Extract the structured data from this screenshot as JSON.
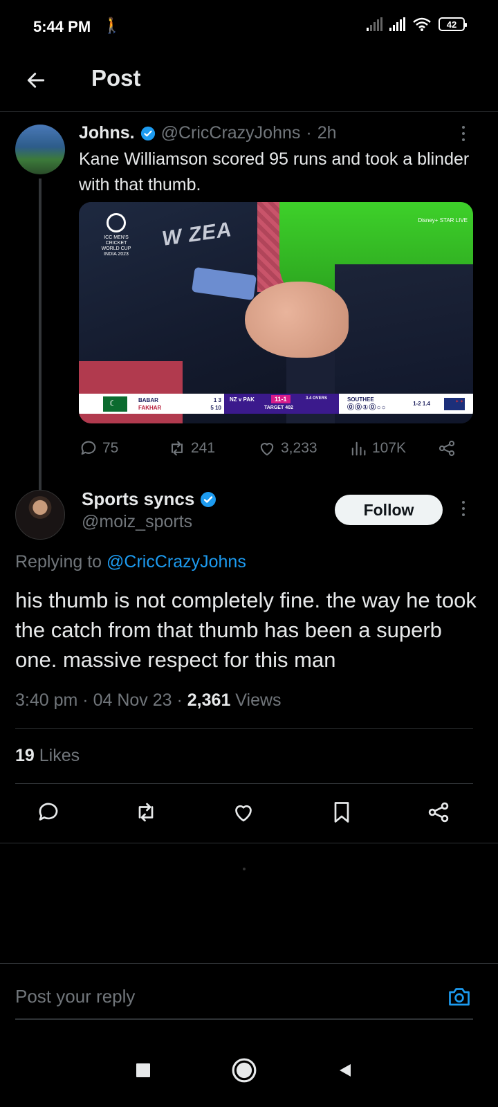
{
  "status_bar": {
    "time": "5:44 PM",
    "battery": "42"
  },
  "header": {
    "title": "Post"
  },
  "parent_post": {
    "name": "Johns.",
    "handle": "@CricCrazyJohns",
    "separator": "·",
    "age": "2h",
    "text": "Kane Williamson scored 95 runs and took a blinder with that thumb.",
    "media": {
      "logo_text": "ICC MEN'S CRICKET WORLD CUP INDIA 2023",
      "shirt_text": "W ZEA",
      "channel_text": "Disney+ STAR LIVE",
      "scoreboard": {
        "batter1": "BABAR",
        "batter1_score": "1 3",
        "batter2": "FAKHAR",
        "batter2_score": "5 10",
        "teams": "NZ v PAK",
        "score": "11-1",
        "overs": "3.4 OVERS",
        "target": "TARGET 402",
        "bowler": "SOUTHEE",
        "balls": "⓪⓪①⓪○○",
        "bowler_figures": "1-2 1.4"
      }
    },
    "stats": {
      "replies": "75",
      "reposts": "241",
      "likes": "3,233",
      "views": "107K"
    }
  },
  "reply_post": {
    "name": "Sports syncs",
    "handle": "@moiz_sports",
    "follow_label": "Follow",
    "replying_prefix": "Replying to",
    "replying_to": "@CricCrazyJohns",
    "text": "his thumb is not completely fine. the way he took the catch from that thumb has been a superb one. massive respect for this man",
    "time": "3:40 pm",
    "date": "04 Nov 23",
    "views_count": "2,361",
    "views_label": "Views",
    "likes_count": "19",
    "likes_label": "Likes"
  },
  "composer": {
    "placeholder": "Post your reply"
  },
  "colors": {
    "accent": "#1d9bf0",
    "background": "#000000",
    "muted": "#71767b",
    "text": "#e7e9ea"
  }
}
